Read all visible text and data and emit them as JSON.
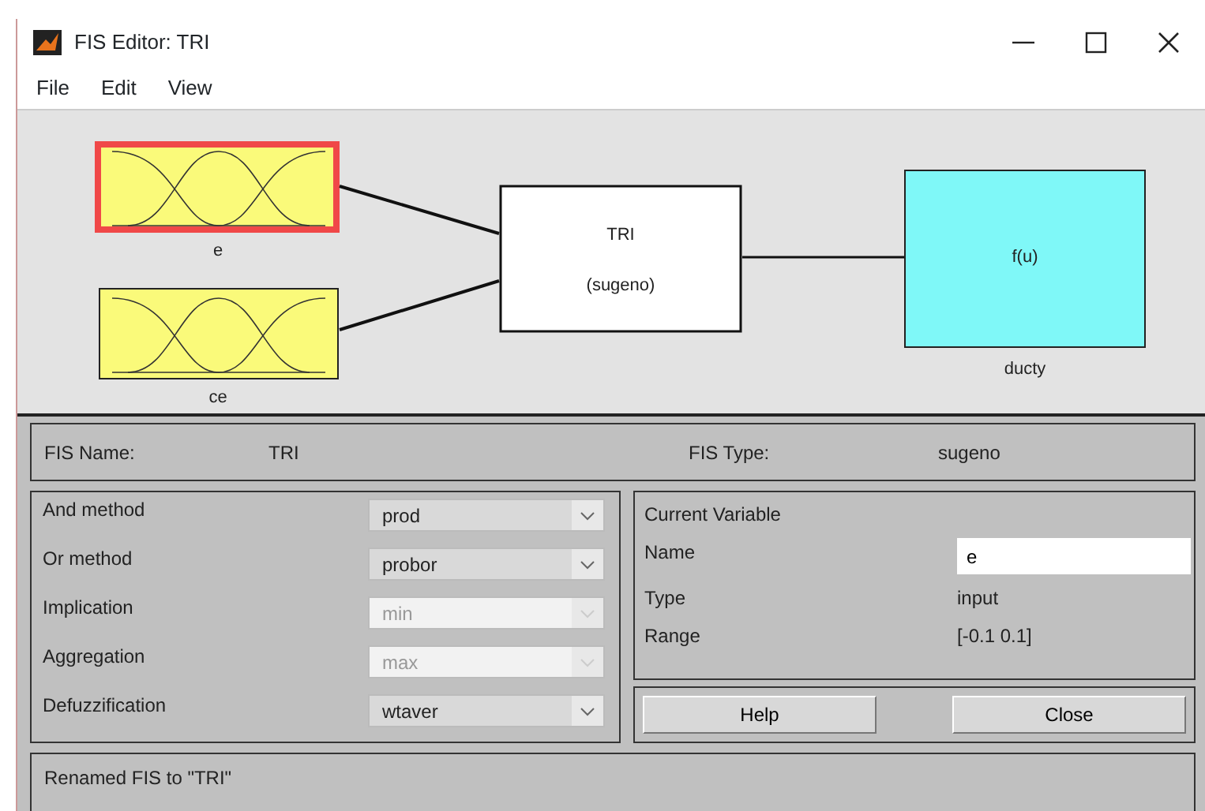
{
  "window": {
    "title": "FIS Editor: TRI"
  },
  "menu": [
    "File",
    "Edit",
    "View"
  ],
  "diagram": {
    "inputs": [
      {
        "name": "e",
        "selected": true
      },
      {
        "name": "ce",
        "selected": false
      }
    ],
    "system": {
      "name": "TRI",
      "type": "(sugeno)"
    },
    "outputs": [
      {
        "name": "ducty",
        "function": "f(u)",
        "selected": false
      }
    ]
  },
  "fis_name": {
    "label": "FIS Name:",
    "value": "TRI"
  },
  "fis_type": {
    "label": "FIS Type:",
    "value": "sugeno"
  },
  "methods": [
    {
      "label": "And method",
      "value": "prod",
      "disabled": false
    },
    {
      "label": "Or method",
      "value": "probor",
      "disabled": false
    },
    {
      "label": "Implication",
      "value": "min",
      "disabled": true
    },
    {
      "label": "Aggregation",
      "value": "max",
      "disabled": true
    },
    {
      "label": "Defuzzification",
      "value": "wtaver",
      "disabled": false
    }
  ],
  "current_variable": {
    "title": "Current Variable",
    "name_label": "Name",
    "name_value": "e",
    "type_label": "Type",
    "type_value": "input",
    "range_label": "Range",
    "range_value": "[-0.1 0.1]"
  },
  "buttons": [
    "Help",
    "Close"
  ],
  "status": "Renamed FIS to \"TRI\""
}
